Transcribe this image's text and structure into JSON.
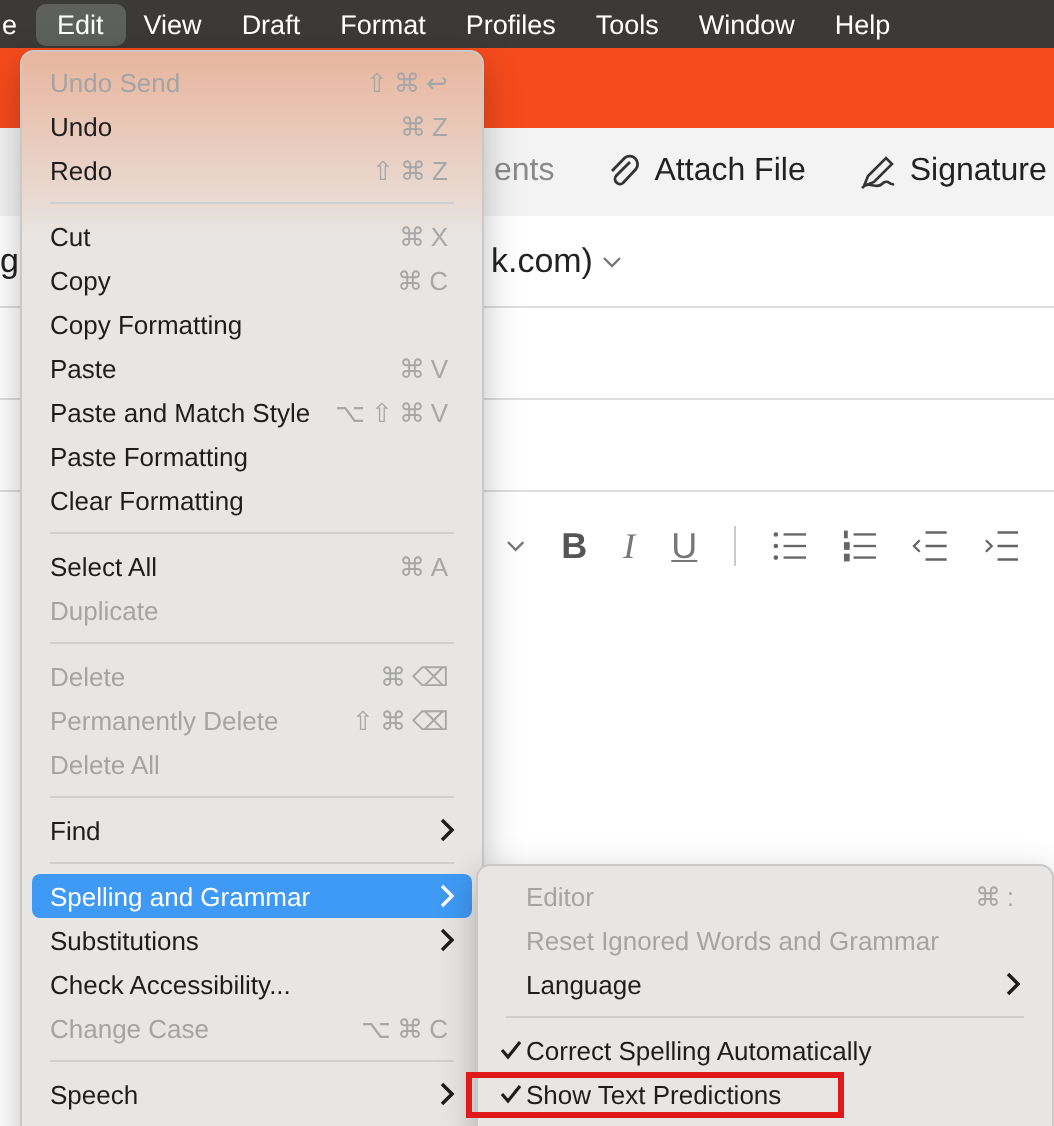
{
  "menubar": {
    "items": [
      {
        "label": "e",
        "selected": false
      },
      {
        "label": "Edit",
        "selected": true
      },
      {
        "label": "View",
        "selected": false
      },
      {
        "label": "Draft",
        "selected": false
      },
      {
        "label": "Format",
        "selected": false
      },
      {
        "label": "Profiles",
        "selected": false
      },
      {
        "label": "Tools",
        "selected": false
      },
      {
        "label": "Window",
        "selected": false
      },
      {
        "label": "Help",
        "selected": false
      }
    ]
  },
  "compose": {
    "toolbar": [
      {
        "kind": "plain",
        "label": "ents"
      },
      {
        "kind": "attach",
        "label": "Attach File"
      },
      {
        "kind": "signature",
        "label": "Signature"
      }
    ],
    "from_parts": [
      "g",
      "k.com)"
    ],
    "format_buttons": [
      "B",
      "I",
      "U"
    ]
  },
  "edit_menu": {
    "groups": [
      {
        "items": [
          {
            "label": "Undo Send",
            "shortcut": "⇧⌘↩",
            "disabled": true,
            "submenu": false,
            "selected": false
          },
          {
            "label": "Undo",
            "shortcut": "⌘Z",
            "disabled": false,
            "submenu": false,
            "selected": false
          },
          {
            "label": "Redo",
            "shortcut": "⇧⌘Z",
            "disabled": false,
            "submenu": false,
            "selected": false
          }
        ]
      },
      {
        "items": [
          {
            "label": "Cut",
            "shortcut": "⌘X",
            "disabled": false,
            "submenu": false,
            "selected": false
          },
          {
            "label": "Copy",
            "shortcut": "⌘C",
            "disabled": false,
            "submenu": false,
            "selected": false
          },
          {
            "label": "Copy Formatting",
            "disabled": false,
            "submenu": false,
            "selected": false
          },
          {
            "label": "Paste",
            "shortcut": "⌘V",
            "disabled": false,
            "submenu": false,
            "selected": false
          },
          {
            "label": "Paste and Match Style",
            "shortcut": "⌥⇧⌘V",
            "disabled": false,
            "submenu": false,
            "selected": false
          },
          {
            "label": "Paste Formatting",
            "disabled": false,
            "submenu": false,
            "selected": false
          },
          {
            "label": "Clear Formatting",
            "disabled": false,
            "submenu": false,
            "selected": false
          }
        ]
      },
      {
        "items": [
          {
            "label": "Select All",
            "shortcut": "⌘A",
            "disabled": false,
            "submenu": false,
            "selected": false
          },
          {
            "label": "Duplicate",
            "disabled": true,
            "submenu": false,
            "selected": false
          }
        ]
      },
      {
        "items": [
          {
            "label": "Delete",
            "shortcut": "⌘⌫",
            "disabled": true,
            "submenu": false,
            "selected": false
          },
          {
            "label": "Permanently Delete",
            "shortcut": "⇧⌘⌫",
            "disabled": true,
            "submenu": false,
            "selected": false
          },
          {
            "label": "Delete All",
            "disabled": true,
            "submenu": false,
            "selected": false
          }
        ]
      },
      {
        "items": [
          {
            "label": "Find",
            "disabled": false,
            "submenu": true,
            "selected": false
          }
        ]
      },
      {
        "items": [
          {
            "label": "Spelling and Grammar",
            "disabled": false,
            "submenu": true,
            "selected": true
          },
          {
            "label": "Substitutions",
            "disabled": false,
            "submenu": true,
            "selected": false
          },
          {
            "label": "Check Accessibility...",
            "disabled": false,
            "submenu": false,
            "selected": false
          },
          {
            "label": "Change Case",
            "shortcut": "⌥⌘C",
            "disabled": true,
            "submenu": false,
            "selected": false
          }
        ]
      },
      {
        "items": [
          {
            "label": "Speech",
            "disabled": false,
            "submenu": true,
            "selected": false
          }
        ]
      }
    ]
  },
  "spelling_submenu": {
    "groups": [
      {
        "items": [
          {
            "label": "Editor",
            "shortcut": "⌘:",
            "disabled": true,
            "submenu": false,
            "selected": false,
            "checked": false,
            "highlighted": false
          },
          {
            "label": "Reset Ignored Words and Grammar",
            "disabled": true,
            "submenu": false,
            "selected": false,
            "checked": false,
            "highlighted": false
          },
          {
            "label": "Language",
            "disabled": false,
            "submenu": true,
            "selected": false,
            "checked": false,
            "highlighted": false
          }
        ]
      },
      {
        "items": [
          {
            "label": "Correct Spelling Automatically",
            "disabled": false,
            "submenu": false,
            "selected": false,
            "checked": true,
            "highlighted": false
          },
          {
            "label": "Show Text Predictions",
            "disabled": false,
            "submenu": false,
            "selected": false,
            "checked": true,
            "highlighted": true
          }
        ]
      }
    ]
  }
}
